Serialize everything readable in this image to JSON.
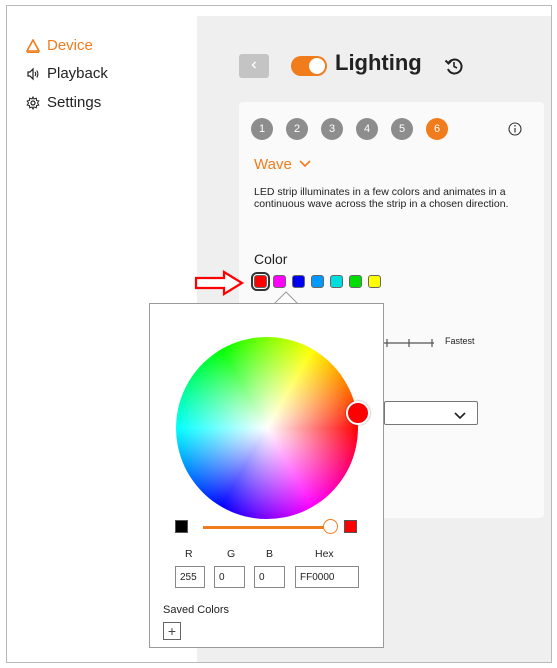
{
  "sidebar": {
    "items": [
      {
        "label": "Device",
        "icon": "device-triangle-icon",
        "active": true
      },
      {
        "label": "Playback",
        "icon": "speaker-icon",
        "active": false
      },
      {
        "label": "Settings",
        "icon": "gear-icon",
        "active": false
      }
    ]
  },
  "header": {
    "title": "Lighting",
    "toggle_on": true
  },
  "steps": [
    "1",
    "2",
    "3",
    "4",
    "5",
    "6"
  ],
  "active_step": "6",
  "effect": {
    "label": "Wave",
    "description": "LED strip illuminates in a few colors and animates in a continuous wave across the strip in a chosen direction."
  },
  "color": {
    "label": "Color",
    "swatches": [
      "#ff0000",
      "#ff00ff",
      "#0000ee",
      "#0099ff",
      "#00dddd",
      "#00dd00",
      "#ffff00"
    ],
    "selected_index": 0
  },
  "speed": {
    "max_label": "Fastest"
  },
  "picker": {
    "r_label": "R",
    "g_label": "G",
    "b_label": "B",
    "hex_label": "Hex",
    "r_value": "255",
    "g_value": "0",
    "b_value": "0",
    "hex_value": "FF0000",
    "saved_label": "Saved Colors",
    "add_symbol": "+",
    "brightness": 1.0
  },
  "colors": {
    "accent": "#f07c1c",
    "step_inactive": "#8d8d8d",
    "main_bg": "#efefef",
    "annotation": "#ff0000"
  }
}
